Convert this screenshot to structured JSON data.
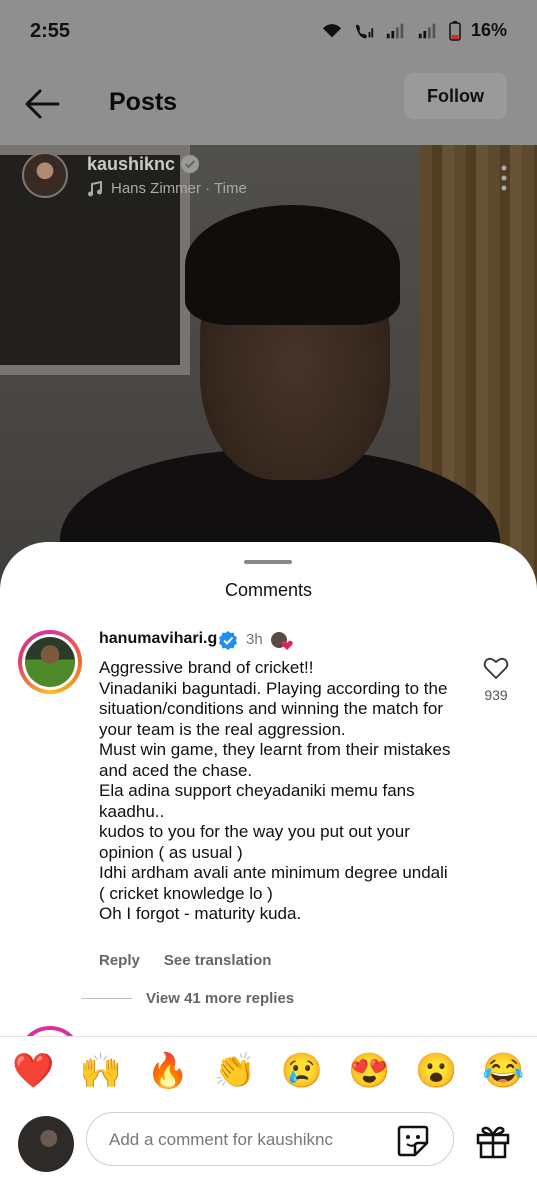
{
  "status_bar": {
    "time": "2:55",
    "battery": "16%"
  },
  "header": {
    "title": "Posts",
    "follow_label": "Follow"
  },
  "post": {
    "author": "kaushiknc",
    "music": "Hans Zimmer · Time"
  },
  "comments_sheet": {
    "title": "Comments",
    "comment": {
      "username": "hanumavihari.g",
      "time": "3h",
      "text": "Aggressive brand of cricket!!\nVinadaniki baguntadi. Playing according to the situation/conditions and winning the match for your team is the real aggression.\nMust win game, they learnt from their mistakes and aced the chase.\nEla adina support cheyadaniki memu fans kaadhu..\nkudos to you for the way you put out your opinion ( as usual )\nIdhi ardham avali ante minimum degree undali ( cricket knowledge lo )\nOh I forgot - maturity kuda.",
      "likes": "939",
      "reply_label": "Reply",
      "translate_label": "See translation"
    },
    "view_replies": "View 41 more replies"
  },
  "emoji_bar": [
    "❤️",
    "🙌",
    "🔥",
    "👏",
    "😢",
    "😍",
    "😮",
    "😂"
  ],
  "composer": {
    "placeholder": "Add a comment for kaushiknc"
  }
}
